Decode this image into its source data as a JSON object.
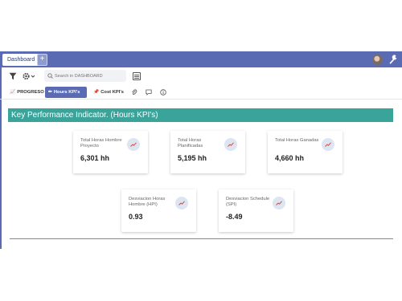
{
  "header": {
    "tab_label": "Dashboard",
    "add_tab_label": "+"
  },
  "toolbar": {
    "search_placeholder": "Search in DASHBOARD"
  },
  "tabs": [
    {
      "label": "PROGRESO",
      "icon": "chart-icon"
    },
    {
      "label": "Hours KPI's",
      "icon": "pencil-icon",
      "active": true
    },
    {
      "label": "Cost KPI's",
      "icon": "pin-icon"
    }
  ],
  "banner": {
    "title": "Key Performance Indicator. (Hours KPI's)"
  },
  "cards": [
    {
      "label": "Total Horas Hombre Proyecto",
      "value": "6,301 hh"
    },
    {
      "label": "Total Horas Planificadas",
      "value": "5,195 hh"
    },
    {
      "label": "Total Horas Ganadas",
      "value": "4,660 hh"
    },
    {
      "label": "Desviacion Horas Hombre (HPI)",
      "value": "0.93"
    },
    {
      "label": "Desviacion Schedule (SPI)",
      "value": "-8.49"
    }
  ],
  "colors": {
    "header_bar": "#5a6bb3",
    "banner": "#3aa39a",
    "icon_bubble": "#dde4f2"
  }
}
